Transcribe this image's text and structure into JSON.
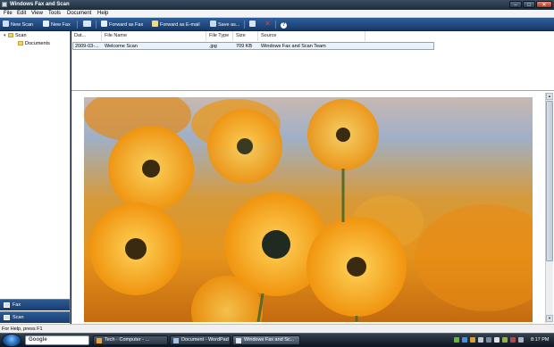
{
  "window": {
    "title": "Windows Fax and Scan"
  },
  "menu": [
    "File",
    "Edit",
    "View",
    "Tools",
    "Document",
    "Help"
  ],
  "toolbar": {
    "new_scan": "New Scan",
    "new_fax": "New Fax",
    "forward_as_fax": "Forward as Fax",
    "forward_as_email": "Forward as E-mail",
    "save_as": "Save as..."
  },
  "tree": {
    "root": "Scan",
    "child": "Documents"
  },
  "nav": {
    "fax": "Fax",
    "scan": "Scan"
  },
  "list": {
    "columns": [
      "Dat...",
      "File Name",
      "File Type",
      "Size",
      "Source"
    ],
    "rows": [
      {
        "date": "2009-03-...",
        "file_name": "Welcome Scan",
        "file_type": ".jpg",
        "size": "709 KB",
        "source": "Windows Fax and Scan Team"
      }
    ]
  },
  "status": "For Help, press F1",
  "taskbar": {
    "search_label": "Google",
    "tasks": [
      "Tech - Computer - ...",
      "Document - WordPad",
      "Windows Fax and Sc..."
    ],
    "clock": "8:17 PM"
  },
  "colors": {
    "toolbar": "#1f4a82",
    "nav": "#173c70",
    "selection": "#e8f2fd"
  }
}
